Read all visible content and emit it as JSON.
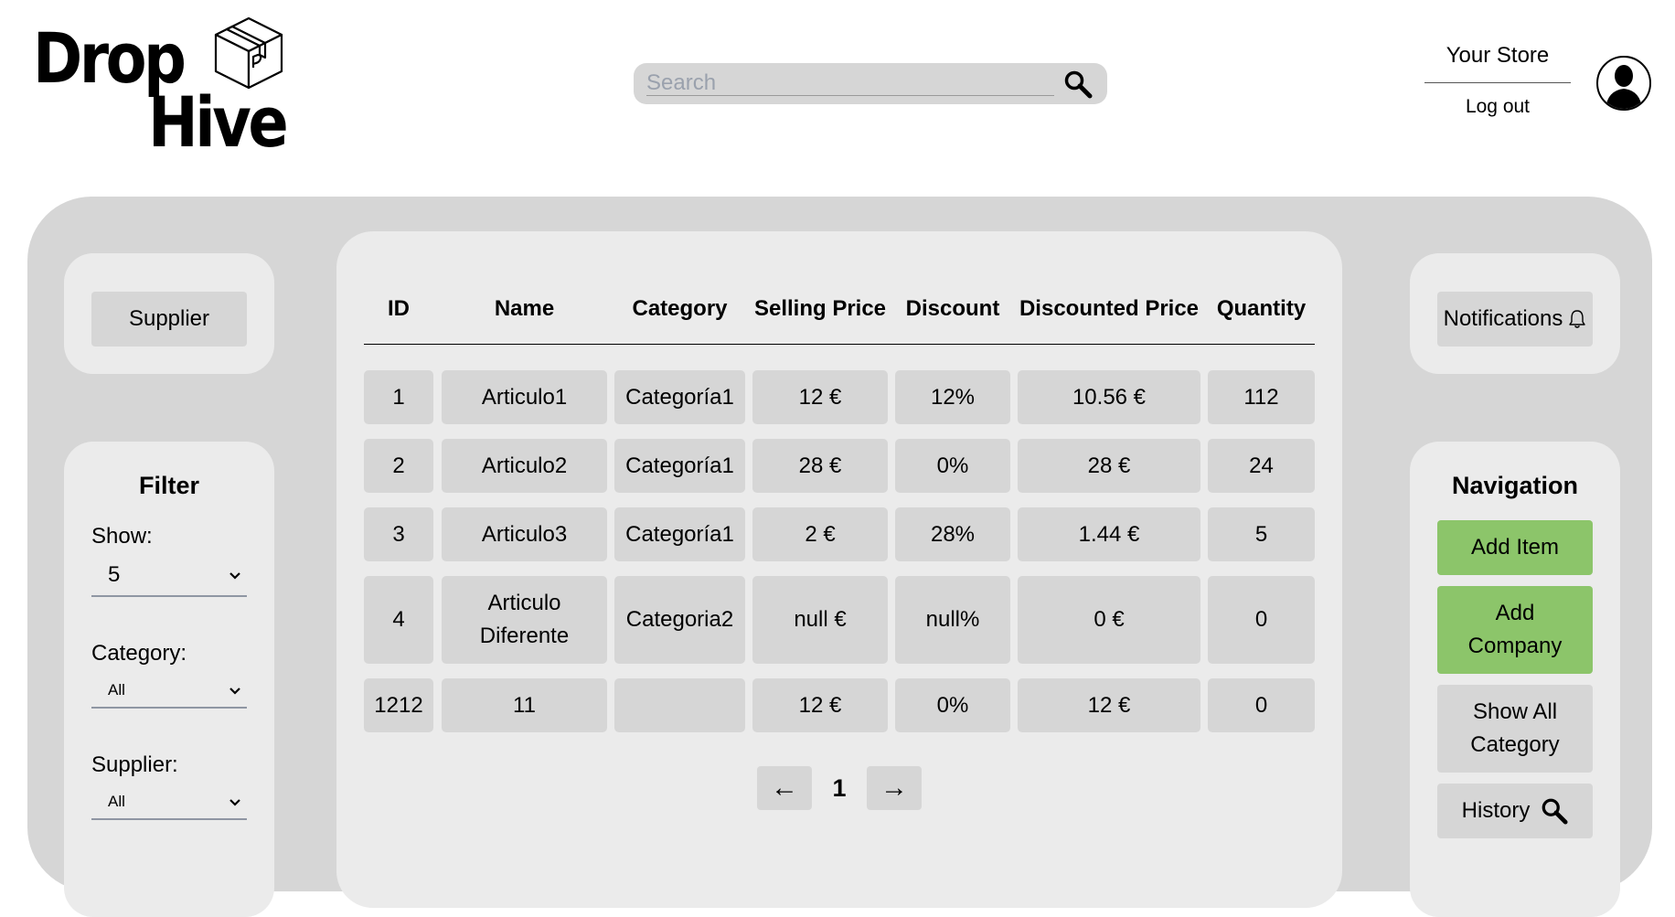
{
  "header": {
    "logo_line1": "Drop",
    "logo_line2": "Hive",
    "search_placeholder": "Search",
    "search_value": "",
    "store_name": "Your Store",
    "logout_label": "Log out"
  },
  "supplier_button": "Supplier",
  "filter": {
    "title": "Filter",
    "show_label": "Show:",
    "show_value": "5",
    "category_label": "Category:",
    "category_value": "All",
    "supplier_label": "Supplier:",
    "supplier_value": "All"
  },
  "table": {
    "headers": [
      "ID",
      "Name",
      "Category",
      "Selling Price",
      "Discount",
      "Discounted Price",
      "Quantity"
    ],
    "rows": [
      [
        "1",
        "Articulo1",
        "Categoría1",
        "12 €",
        "12%",
        "10.56 €",
        "112"
      ],
      [
        "2",
        "Articulo2",
        "Categoría1",
        "28 €",
        "0%",
        "28 €",
        "24"
      ],
      [
        "3",
        "Articulo3",
        "Categoría1",
        "2 €",
        "28%",
        "1.44 €",
        "5"
      ],
      [
        "4",
        "Articulo Diferente",
        "Categoria2",
        "null €",
        "null%",
        "0 €",
        "0"
      ],
      [
        "1212",
        "11",
        "",
        "12 €",
        "0%",
        "12 €",
        "0"
      ]
    ]
  },
  "pagination": {
    "prev": "←",
    "page": "1",
    "next": "→"
  },
  "notifications_button": "Notifications",
  "navigation": {
    "title": "Navigation",
    "add_item": "Add Item",
    "add_company": "Add Company",
    "show_all_category": "Show All Category",
    "history": "History"
  },
  "colors": {
    "panel_gray": "#d6d6d6",
    "card_gray": "#ebebeb",
    "action_green": "#8cc56a",
    "underline_gray": "#8f96a3"
  },
  "icons": {
    "logo": "box-icon",
    "search": "search-icon",
    "avatar": "user-icon",
    "notifications": "bell-icon",
    "select": "chevron-down-icon",
    "history": "search-icon"
  }
}
